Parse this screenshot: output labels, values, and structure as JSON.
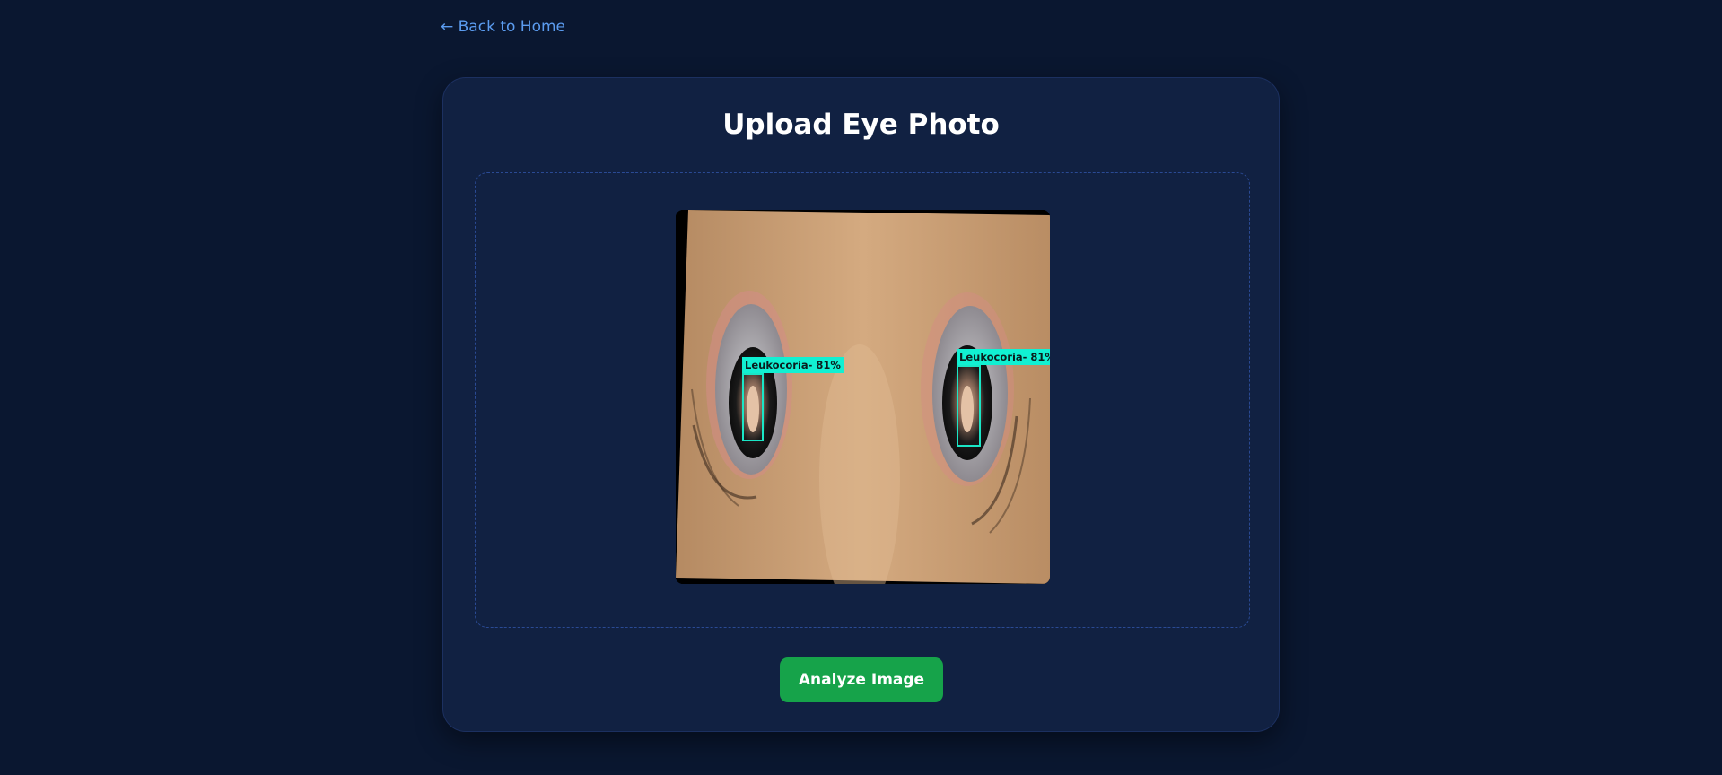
{
  "nav": {
    "back_label": "← Back to Home"
  },
  "upload": {
    "title": "Upload Eye Photo",
    "analyze_label": "Analyze Image"
  },
  "detections": [
    {
      "label": "Leukocoria- 81%"
    },
    {
      "label": "Leukocoria- 81%"
    }
  ],
  "colors": {
    "background": "#0a1730",
    "card": "#112142",
    "link": "#5b9cf0",
    "button": "#16a34a",
    "detection": "#1ae6c6"
  }
}
